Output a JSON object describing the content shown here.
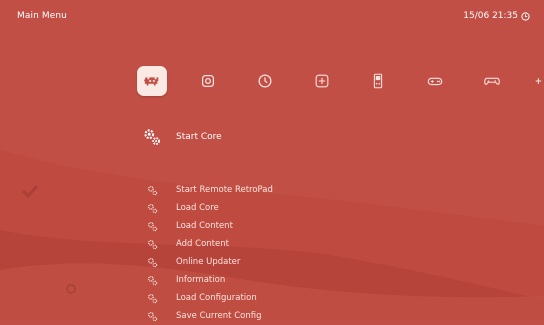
{
  "header": {
    "title": "Main Menu",
    "datetime": "15/06 21:35",
    "clock_icon": "clock-icon"
  },
  "colors": {
    "background": "#c24f45",
    "wave_light": "#cb5e53",
    "wave_dark": "#b9463c",
    "active_tab_bg": "#fbe9e4",
    "text": "#ffffff"
  },
  "tabs": [
    {
      "icon": "retroarch-invader-icon",
      "active": true
    },
    {
      "icon": "settings-gear-icon",
      "active": false
    },
    {
      "icon": "history-icon",
      "active": false
    },
    {
      "icon": "add-icon",
      "active": false
    },
    {
      "icon": "handheld-console-icon",
      "active": false
    },
    {
      "icon": "gamepad-icon",
      "active": false
    },
    {
      "icon": "controller-icon",
      "active": false
    },
    {
      "icon": "partial-tab-icon",
      "active": false
    }
  ],
  "menu": {
    "items": [
      {
        "label": "Start Core",
        "icon": "gears-icon",
        "selected": true
      },
      {
        "label": "Start Remote RetroPad",
        "icon": "gears-icon"
      },
      {
        "label": "Load Core",
        "icon": "gears-icon"
      },
      {
        "label": "Load Content",
        "icon": "gears-icon"
      },
      {
        "label": "Add Content",
        "icon": "gears-icon"
      },
      {
        "label": "Online Updater",
        "icon": "gears-icon"
      },
      {
        "label": "Information",
        "icon": "gears-icon"
      },
      {
        "label": "Load Configuration",
        "icon": "gears-icon"
      },
      {
        "label": "Save Current Config",
        "icon": "gears-icon"
      }
    ]
  }
}
